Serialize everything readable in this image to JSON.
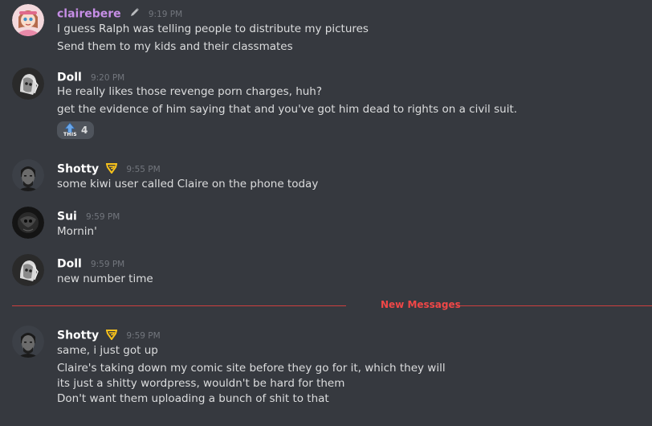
{
  "messages": [
    {
      "username": "clairebere",
      "time": "9:19 PM",
      "lines": [
        "I guess Ralph was telling people to distribute my pictures",
        "Send them to my kids and their classmates"
      ]
    },
    {
      "username": "Doll",
      "time": "9:20 PM",
      "lines": [
        "He really likes those revenge porn charges, huh?",
        "get the evidence of him saying that and you've got him dead to rights on a civil suit."
      ],
      "reaction": {
        "emoji_text": "THIS",
        "count": "4"
      }
    },
    {
      "username": "Shotty",
      "time": "9:55 PM",
      "lines": [
        "some kiwi user called Claire on the phone today"
      ]
    },
    {
      "username": "Sui",
      "time": "9:59 PM",
      "lines": [
        "Mornin'"
      ]
    },
    {
      "username": "Doll",
      "time": "9:59 PM",
      "lines": [
        "new number time"
      ]
    },
    {
      "username": "Shotty",
      "time": "9:59 PM",
      "lines": [
        "same, i just got up",
        "Claire's taking down my comic site before they go for it, which they will",
        "its just a shitty wordpress, wouldn't be hard for them",
        "Don't want them uploading a bunch of shit to that"
      ]
    }
  ],
  "divider": {
    "label": "New Messages"
  },
  "colors": {
    "background": "#36393f",
    "text": "#dcddde",
    "timestamp": "#72767d",
    "clairebere_name": "#c68ee6",
    "new_messages": "#f04747",
    "hypesquad_badge": "#f8c21b"
  },
  "icons": {
    "clairebere_badge": "pencil-icon",
    "shotty_badge": "hypesquad-icon",
    "reaction_emoji": "this-arrow-icon"
  }
}
